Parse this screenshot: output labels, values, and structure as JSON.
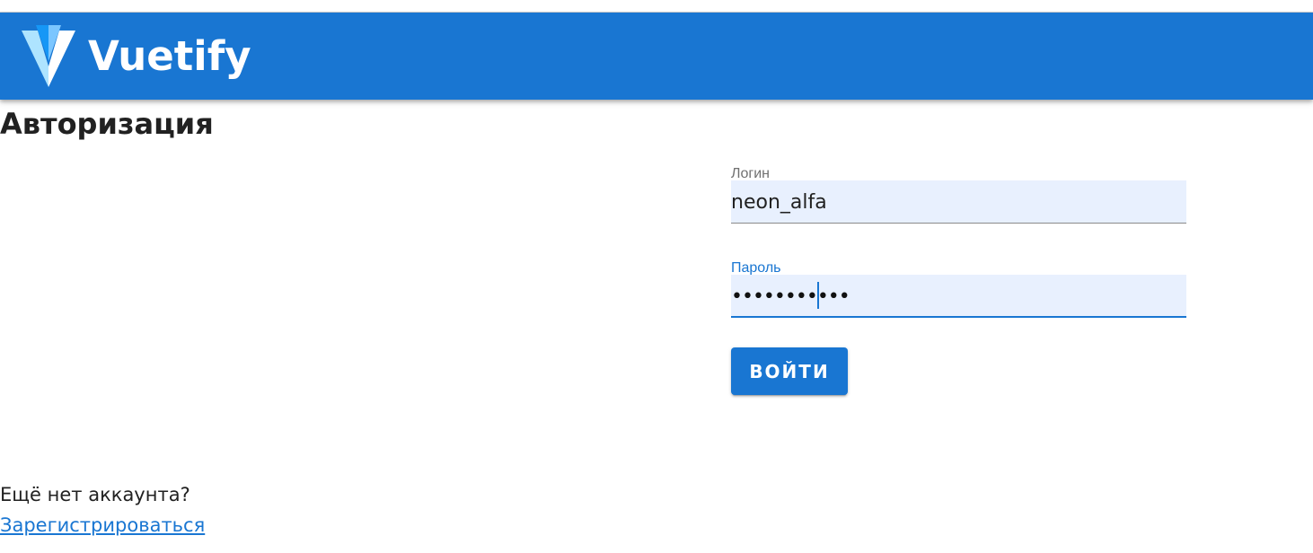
{
  "app_bar": {
    "brand": "Vuetify",
    "logo_icon": "vuetify-logo-icon",
    "color": "#1976d2"
  },
  "page": {
    "title": "Авторизация"
  },
  "login_form": {
    "login_label": "Логин",
    "login_value": "neon_alfa",
    "password_label": "Пароль",
    "password_masked": "•••••••••••",
    "submit_label": "ВОЙТИ"
  },
  "footer": {
    "no_account_text": "Ещё нет аккаунта?",
    "register_link": "Зарегистрироваться"
  },
  "colors": {
    "primary": "#1976d2",
    "field_bg": "#e8f0fe"
  }
}
